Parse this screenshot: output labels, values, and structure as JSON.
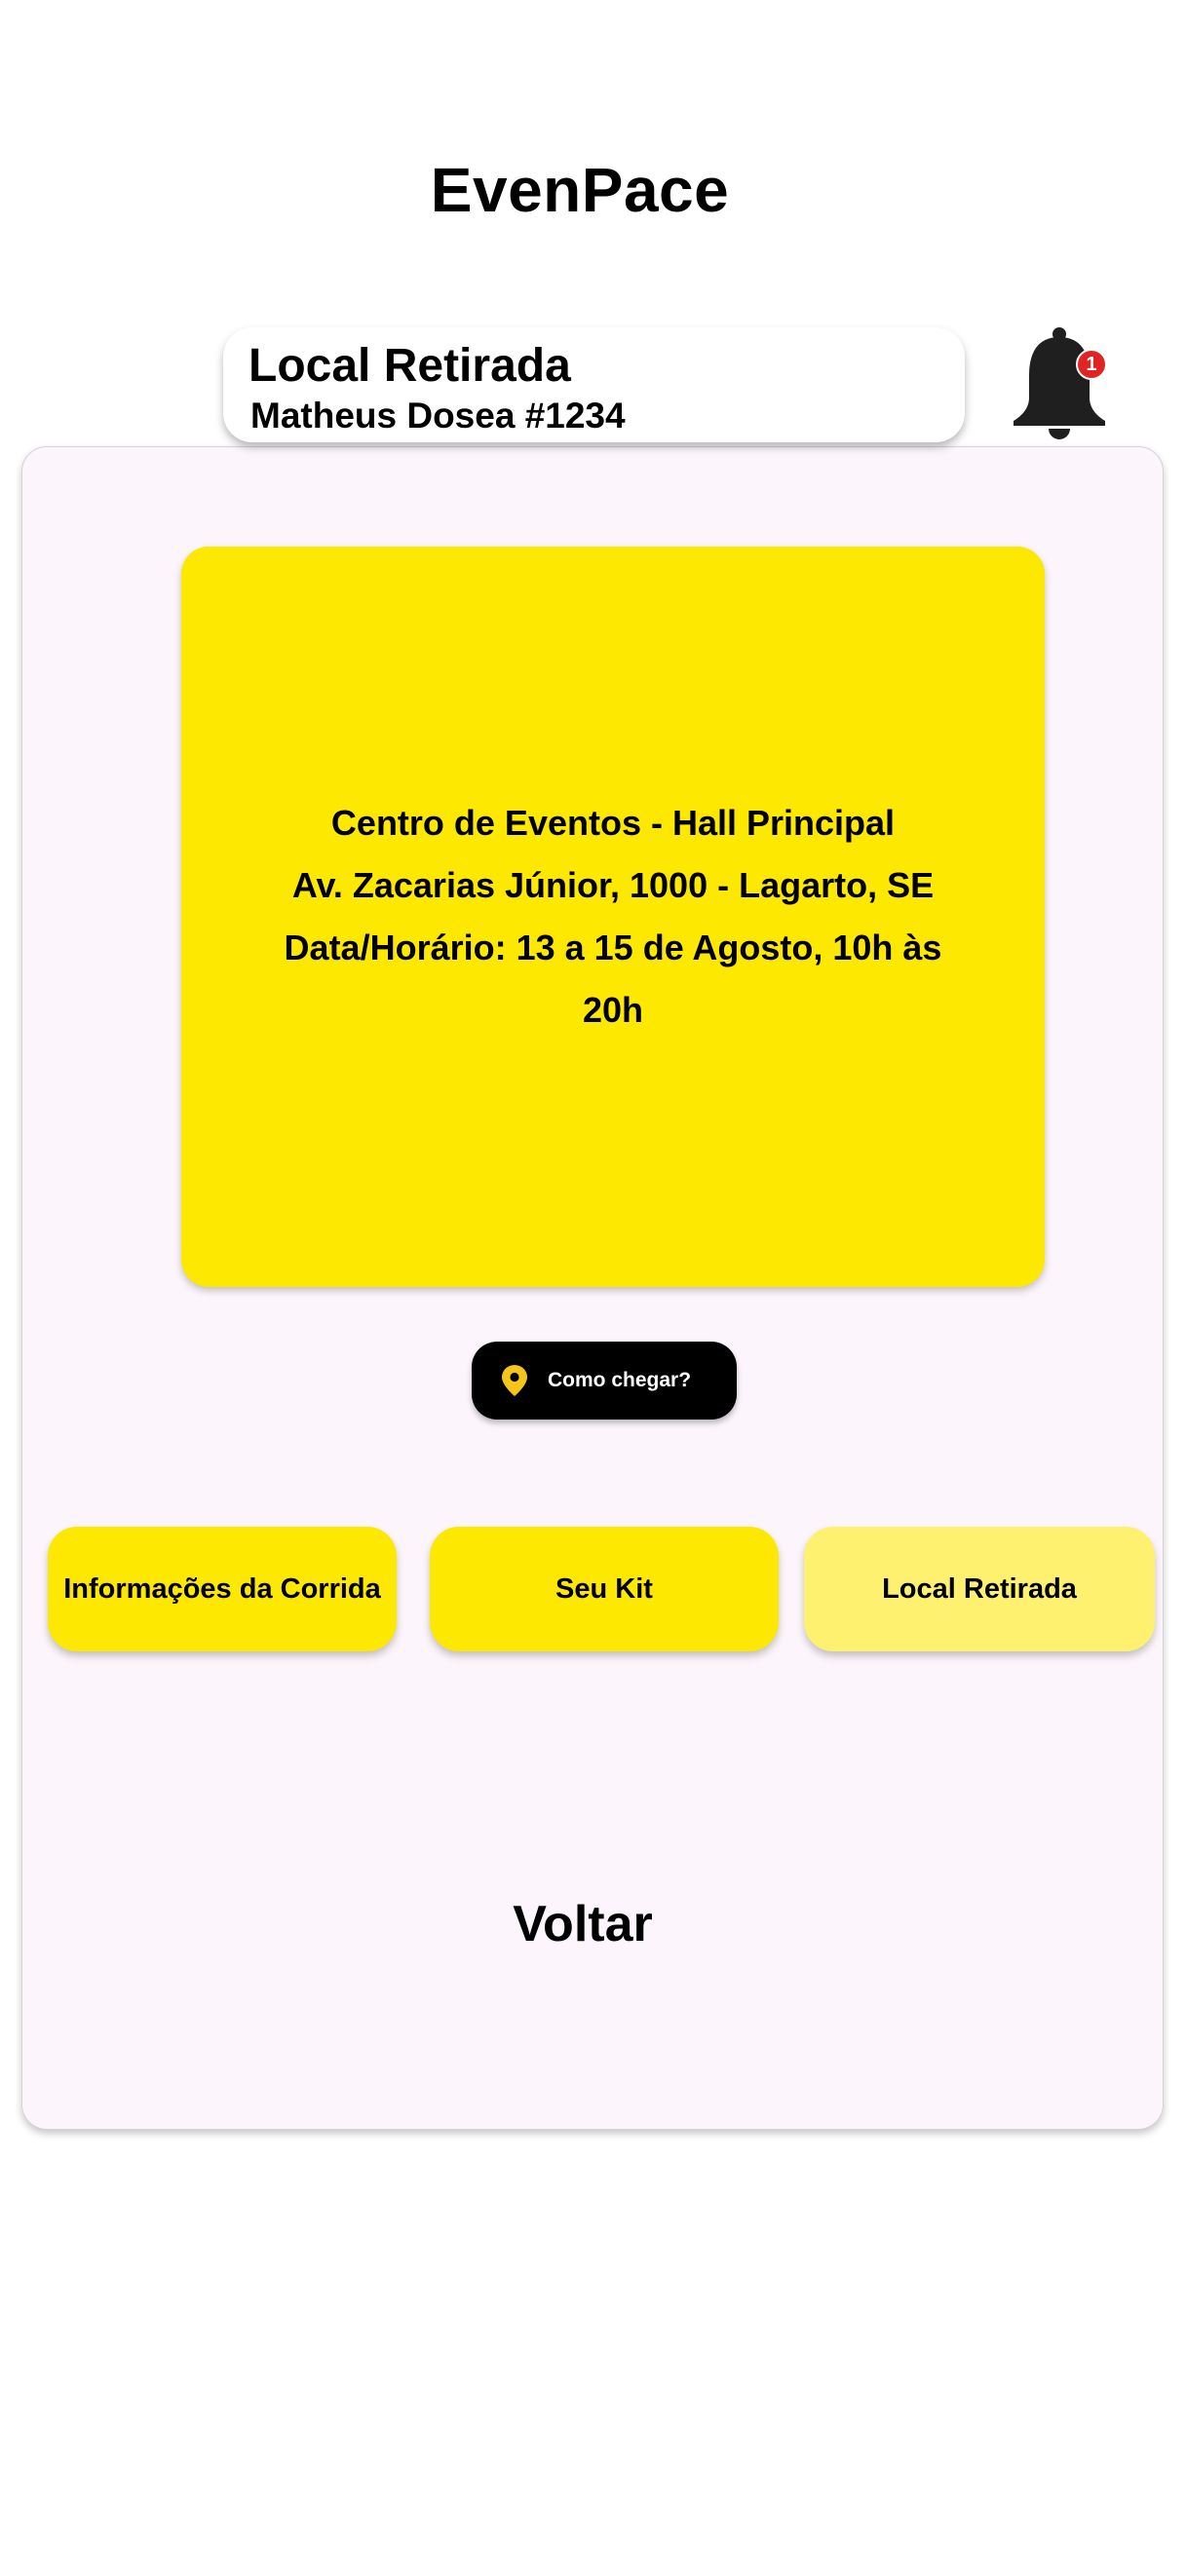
{
  "app": {
    "title": "EvenPace"
  },
  "header": {
    "title": "Local Retirada",
    "subtitle": "Matheus Dosea #1234",
    "notification_count": "1"
  },
  "location_card": {
    "lines": [
      "Centro de Eventos - Hall Principal",
      "Av. Zacarias Júnior, 1000 - Lagarto, SE",
      "Data/Horário: 13 a 15 de Agosto, 10h às 20h"
    ]
  },
  "directions_button": {
    "label": "Como chegar?",
    "icon": "map-pin-icon"
  },
  "tabs": [
    {
      "label": "Informações da Corrida",
      "active": false
    },
    {
      "label": "Seu Kit",
      "active": false
    },
    {
      "label": "Local Retirada",
      "active": true
    }
  ],
  "back_link": {
    "label": "Voltar"
  },
  "colors": {
    "accent_yellow": "#fce800",
    "active_tab_yellow": "#fff170",
    "panel_background": "#fcf6fc",
    "badge_red": "#e02424"
  }
}
